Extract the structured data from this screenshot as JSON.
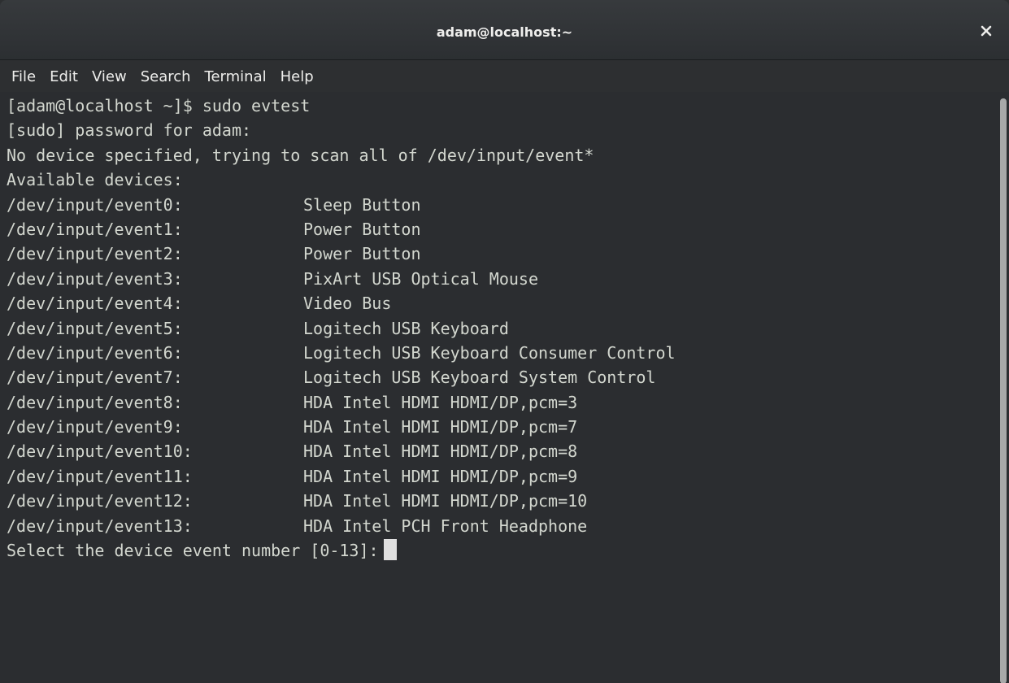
{
  "window": {
    "title": "adam@localhost:~"
  },
  "menu": [
    "File",
    "Edit",
    "View",
    "Search",
    "Terminal",
    "Help"
  ],
  "terminal": {
    "lines": [
      "[adam@localhost ~]$ sudo evtest",
      "[sudo] password for adam:",
      "No device specified, trying to scan all of /dev/input/event*",
      "Available devices:"
    ],
    "devices": [
      {
        "path": "/dev/input/event0:",
        "name": "Sleep Button"
      },
      {
        "path": "/dev/input/event1:",
        "name": "Power Button"
      },
      {
        "path": "/dev/input/event2:",
        "name": "Power Button"
      },
      {
        "path": "/dev/input/event3:",
        "name": "PixArt USB Optical Mouse"
      },
      {
        "path": "/dev/input/event4:",
        "name": "Video Bus"
      },
      {
        "path": "/dev/input/event5:",
        "name": "Logitech USB Keyboard"
      },
      {
        "path": "/dev/input/event6:",
        "name": "Logitech USB Keyboard Consumer Control"
      },
      {
        "path": "/dev/input/event7:",
        "name": "Logitech USB Keyboard System Control"
      },
      {
        "path": "/dev/input/event8:",
        "name": "HDA Intel HDMI HDMI/DP,pcm=3"
      },
      {
        "path": "/dev/input/event9:",
        "name": "HDA Intel HDMI HDMI/DP,pcm=7"
      },
      {
        "path": "/dev/input/event10:",
        "name": "HDA Intel HDMI HDMI/DP,pcm=8"
      },
      {
        "path": "/dev/input/event11:",
        "name": "HDA Intel HDMI HDMI/DP,pcm=9"
      },
      {
        "path": "/dev/input/event12:",
        "name": "HDA Intel HDMI HDMI/DP,pcm=10"
      },
      {
        "path": "/dev/input/event13:",
        "name": "HDA Intel PCH Front Headphone"
      }
    ],
    "prompt": "Select the device event number [0-13]:"
  },
  "colors": {
    "background": "#2b2d30",
    "text": "#d3d7cf",
    "cursor": "#e0e0e0"
  },
  "icons": {
    "close": "close-icon"
  }
}
